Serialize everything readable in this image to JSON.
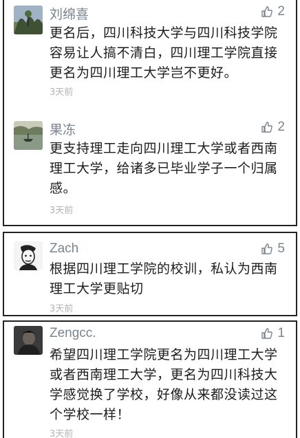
{
  "comments": [
    {
      "author": "刘绵喜",
      "likes": "2",
      "text": "更名后，四川科技大学与四川科技学院容易让人搞不清白，四川理工学院直接更名为四川理工大学岂不更好。",
      "time": "3天前",
      "avatar_icon": "landscape-avatar"
    },
    {
      "author": "果冻",
      "likes": "2",
      "text": "更支持理工走向四川理工大学或者西南理工大学，给诸多已毕业学子一个归属感。",
      "time": "3天前",
      "avatar_icon": "lake-boat-avatar"
    },
    {
      "author": "Zach",
      "likes": "5",
      "text": "根据四川理工学院的校训，私认为西南理工大学更贴切",
      "time": "3天前",
      "avatar_icon": "sketch-face-avatar"
    },
    {
      "author": "Zengcc.",
      "likes": "1",
      "text": "希望四川理工学院更名为四川理工大学或者西南理工大学，更名为四川科技大学感觉换了学校，好像从来都没读过这个学校一样！",
      "time": "3天前",
      "avatar_icon": "dark-photo-avatar"
    }
  ],
  "colors": {
    "meta": "#7a8490",
    "text": "#1c1c1c",
    "time": "#b4b4b4",
    "border": "#222222"
  }
}
